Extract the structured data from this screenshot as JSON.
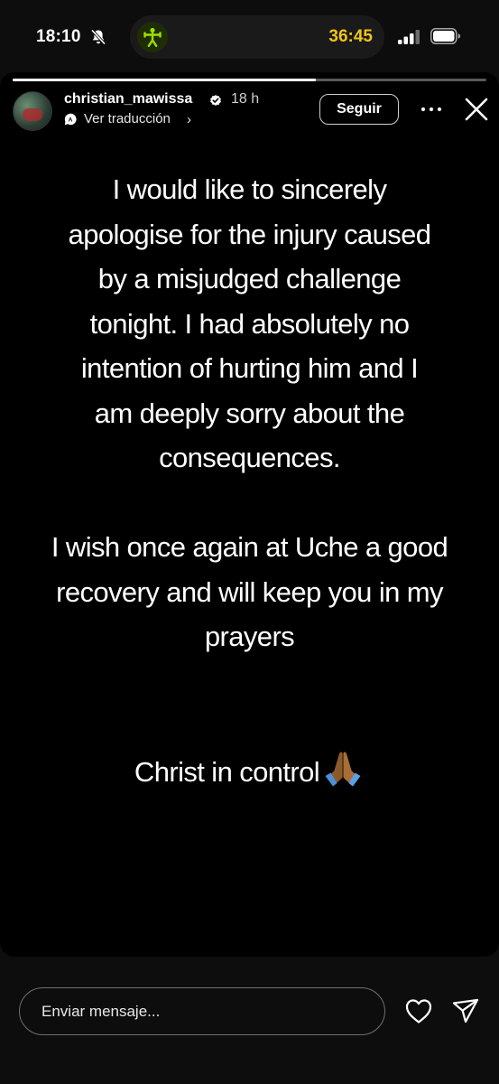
{
  "status_bar": {
    "time": "18:10",
    "timer": "36:45",
    "icons": [
      "bell-slash-icon",
      "fitness-activity-icon",
      "cellular-signal-icon",
      "battery-icon"
    ]
  },
  "story": {
    "progress_fraction": 0.64,
    "username": "christian_mawissa",
    "age": "18 h",
    "translate_label": "Ver traducción",
    "translate_chevron": "›",
    "follow_label": "Seguir",
    "caption_lines": [
      "I would like to sincerely",
      "apologise for the injury caused",
      "by a misjudged challenge",
      "tonight. I had absolutely no",
      "intention of hurting him and I",
      "am deeply sorry about the",
      "consequences.",
      "I wish once again at Uche a good",
      "recovery and will keep you in my",
      "prayers",
      "Christ in control"
    ],
    "closing_emoji": "folded-hands-emoji"
  },
  "bottom_bar": {
    "message_placeholder": "Enviar mensaje...",
    "icons": [
      "heart-icon",
      "send-icon"
    ]
  },
  "colors": {
    "timer": "#f0c419",
    "island_icon": "#9be000",
    "story_background": "#000000",
    "page_background": "#0d0d0d"
  }
}
